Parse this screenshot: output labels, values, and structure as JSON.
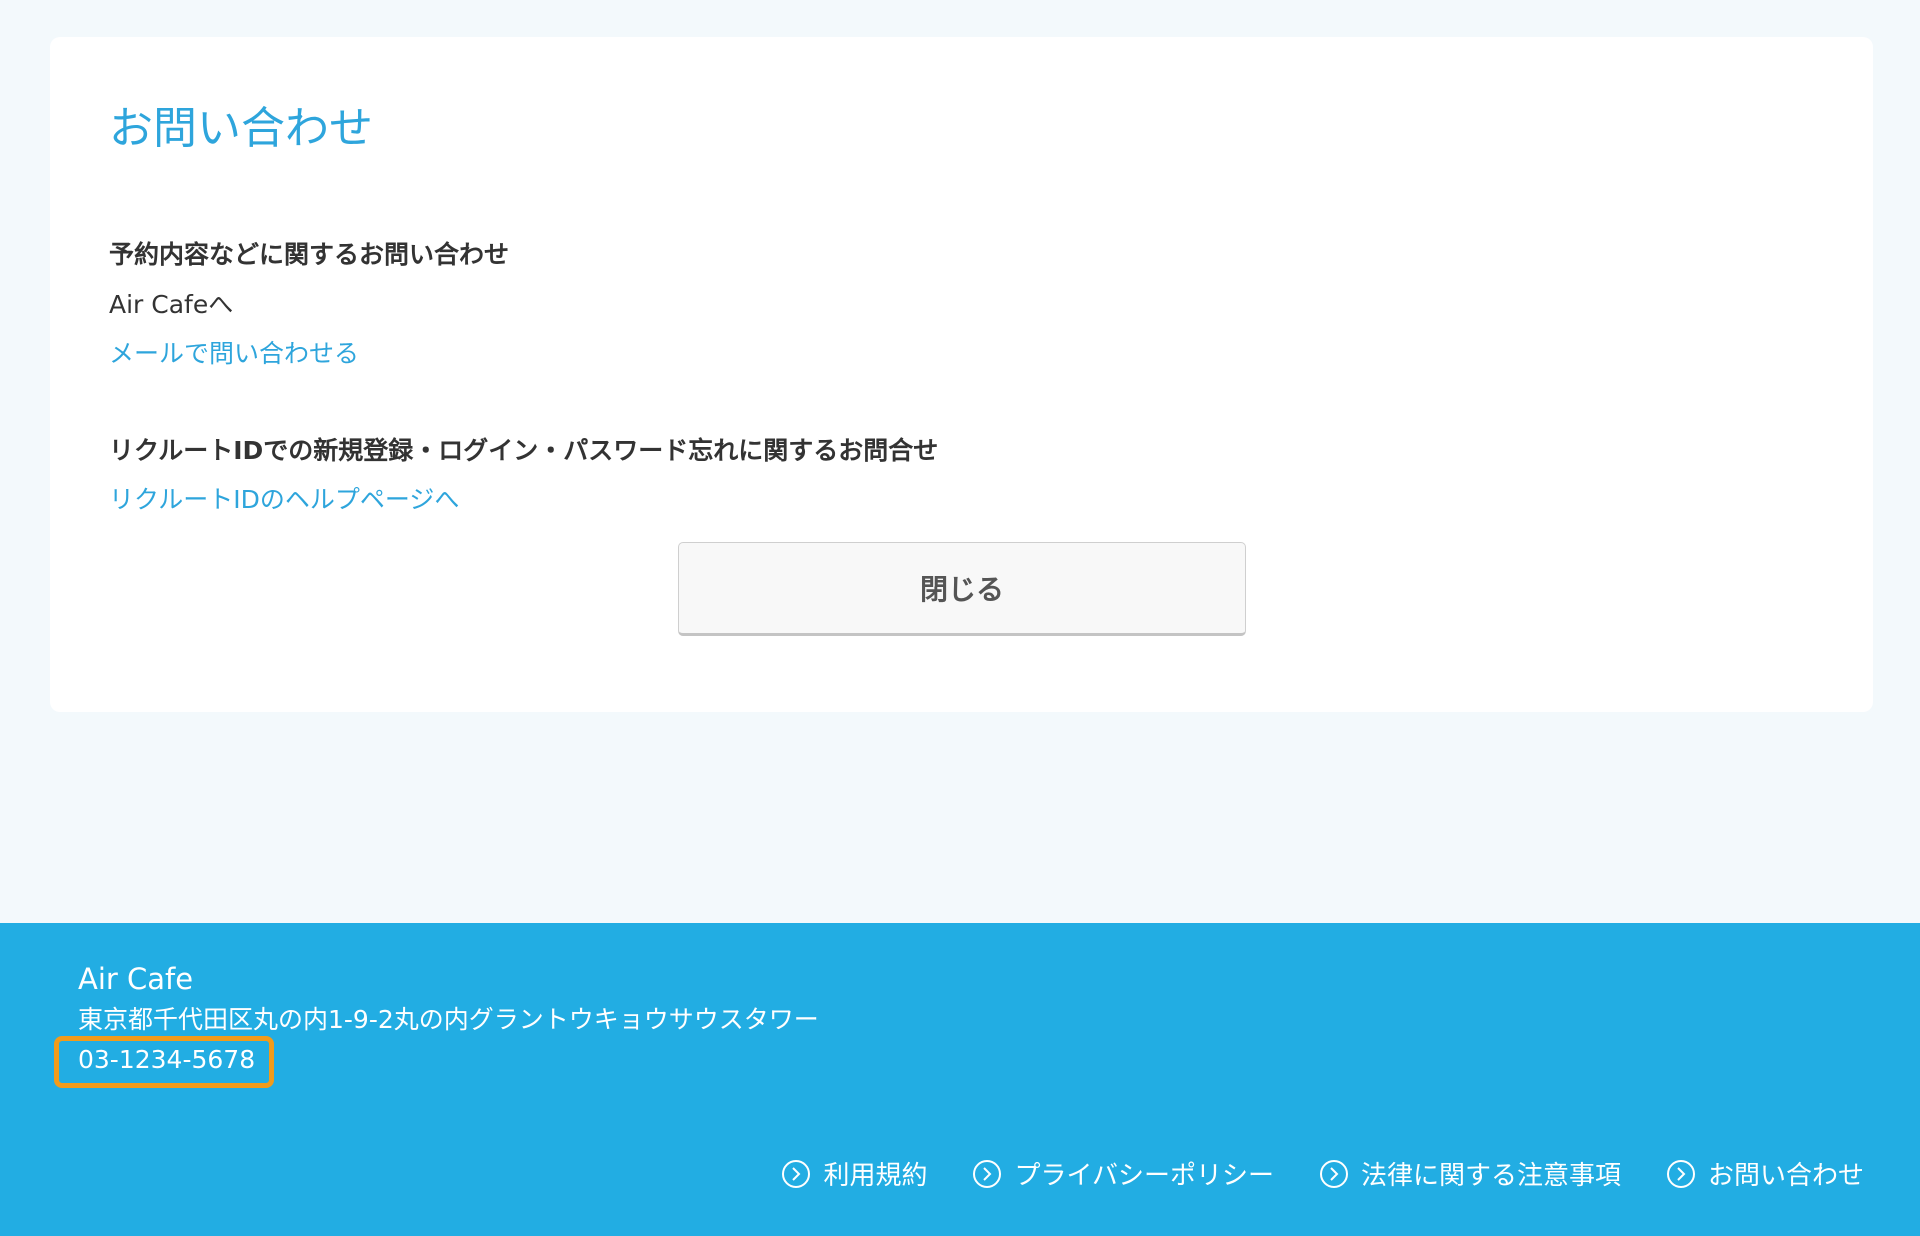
{
  "page": {
    "title": "お問い合わせ"
  },
  "sections": [
    {
      "heading": "予約内容などに関するお問い合わせ",
      "text": "Air Cafeへ",
      "link": "メールで問い合わせる"
    },
    {
      "heading": "リクルートIDでの新規登録・ログイン・パスワード忘れに関するお問合せ",
      "link": "リクルートIDのヘルプページへ"
    }
  ],
  "close_button": {
    "label": "閉じる"
  },
  "footer": {
    "name": "Air Cafe",
    "address": "東京都千代田区丸の内1-9-2丸の内グラントウキョウサウスタワー",
    "phone": "03-1234-5678",
    "links": [
      {
        "label": "利用規約",
        "icon": "circle-chevron-right-icon"
      },
      {
        "label": "プライバシーポリシー",
        "icon": "circle-chevron-right-icon"
      },
      {
        "label": "法律に関する注意事項",
        "icon": "circle-chevron-right-icon"
      },
      {
        "label": "お問い合わせ",
        "icon": "circle-chevron-right-icon"
      }
    ]
  },
  "colors": {
    "accent": "#2ea5dc",
    "footer_background": "#22ade3",
    "highlight": "#f29b1a",
    "page_background": "#f3f9fc"
  }
}
